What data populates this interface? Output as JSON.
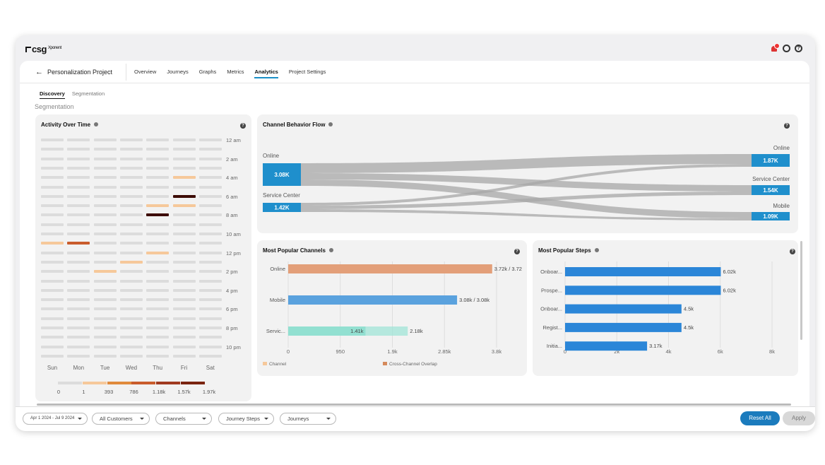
{
  "app": {
    "logo": "csg",
    "logo_sup": "Xponent"
  },
  "header": {
    "back_label": "Personalization Project",
    "nav": [
      "Overview",
      "Journeys",
      "Graphs",
      "Metrics",
      "Analytics",
      "Project Settings"
    ],
    "active_nav": "Analytics"
  },
  "subtabs": {
    "items": [
      "Discovery",
      "Segmentation"
    ],
    "active": "Discovery"
  },
  "section_title": "Segmentation",
  "activity": {
    "title": "Activity Over Time",
    "days": [
      "Sun",
      "Mon",
      "Tue",
      "Wed",
      "Thu",
      "Fri",
      "Sat"
    ],
    "hours": [
      "12 am",
      "2 am",
      "4 am",
      "6 am",
      "8 am",
      "10 am",
      "12 pm",
      "2 pm",
      "4 pm",
      "6 pm",
      "8 pm",
      "10 pm"
    ],
    "legend_values": [
      "0",
      "1",
      "393",
      "786",
      "1.18k",
      "1.57k",
      "1.97k"
    ],
    "legend_colors": [
      "#dcdcdc",
      "#f6c89a",
      "#e08a3c",
      "#c95c2c",
      "#a03a20",
      "#7a2410",
      "#3d0c05"
    ]
  },
  "flow": {
    "title": "Channel Behavior Flow",
    "left": [
      {
        "name": "Online",
        "value": "3.08K"
      },
      {
        "name": "Service Center",
        "value": "1.42K"
      }
    ],
    "right": [
      {
        "name": "Online",
        "value": "1.87K"
      },
      {
        "name": "Service Center",
        "value": "1.54K"
      },
      {
        "name": "Mobile",
        "value": "1.09K"
      }
    ],
    "color": "#1f8fcc"
  },
  "channels": {
    "title": "Most Popular Channels",
    "legend": [
      "Channel",
      "Cross-Channel Overlap"
    ],
    "ticks": [
      "0",
      "950",
      "1.9k",
      "2.85k",
      "3.8k"
    ]
  },
  "steps": {
    "title": "Most Popular Steps",
    "ticks": [
      "0",
      "2k",
      "4k",
      "6k",
      "8k"
    ]
  },
  "chart_data": [
    {
      "type": "bar",
      "title": "Most Popular Channels",
      "categories": [
        "Online",
        "Mobile",
        "Servic..."
      ],
      "series": [
        {
          "name": "Channel",
          "values": [
            3.72,
            3.08,
            1.41
          ]
        }
      ],
      "value_labels": [
        "3.72k / 3.72",
        "3.08k / 3.08k",
        "1.41k",
        "2.18k"
      ],
      "overlap_values": [
        null,
        null,
        2.18
      ],
      "colors": [
        "#e39f79",
        "#5aa2de",
        "#7ed8c6"
      ],
      "xlim": [
        0,
        3.8
      ]
    },
    {
      "type": "bar",
      "title": "Most Popular Steps",
      "categories": [
        "Onboar...",
        "Prospe...",
        "Onboar...",
        "Regist...",
        "Initia..."
      ],
      "values": [
        6.02,
        6.02,
        4.5,
        4.5,
        3.17
      ],
      "value_labels": [
        "6.02k",
        "6.02k",
        "4.5k",
        "4.5k",
        "3.17k"
      ],
      "color": "#2b86d8",
      "xlim": [
        0,
        8
      ]
    }
  ],
  "filters": [
    {
      "label": "Apr 1 2024 - Jul 9 2024"
    },
    {
      "label": "All Customers"
    },
    {
      "label": "Channels"
    },
    {
      "label": "Journey Steps"
    },
    {
      "label": "Journeys"
    }
  ],
  "buttons": {
    "reset": "Reset All",
    "apply": "Apply"
  }
}
